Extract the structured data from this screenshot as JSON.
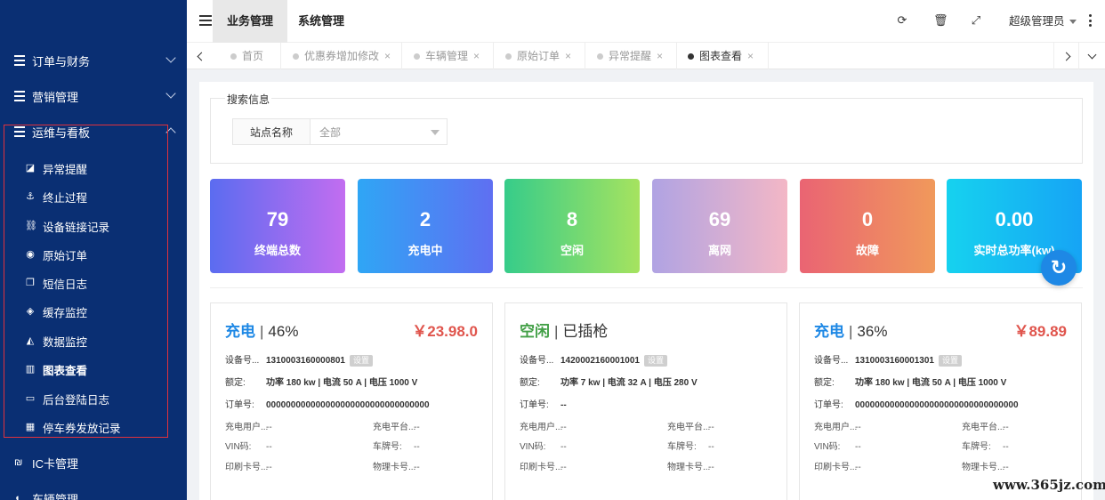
{
  "sidebar": {
    "groups": [
      {
        "label": "订单与财务"
      },
      {
        "label": "营销管理"
      },
      {
        "label": "运维与看板"
      },
      {
        "label": "IC卡管理"
      },
      {
        "label": "车辆管理"
      }
    ],
    "items": [
      {
        "label": "异常提醒",
        "icon": "dashboard-icon"
      },
      {
        "label": "终止过程",
        "icon": "anchor-icon"
      },
      {
        "label": "设备链接记录",
        "icon": "link-icon"
      },
      {
        "label": "原始订单",
        "icon": "compass-icon"
      },
      {
        "label": "短信日志",
        "icon": "copy-icon"
      },
      {
        "label": "缓存监控",
        "icon": "cache-icon"
      },
      {
        "label": "数据监控",
        "icon": "area-chart-icon"
      },
      {
        "label": "图表查看",
        "icon": "bar-chart-icon"
      },
      {
        "label": "后台登陆日志",
        "icon": "monitor-icon"
      },
      {
        "label": "停车券发放记录",
        "icon": "grid-icon"
      }
    ]
  },
  "header": {
    "tabs": [
      "业务管理",
      "系统管理"
    ],
    "user": "超级管理员"
  },
  "page_tabs": [
    {
      "label": "首页",
      "closable": false
    },
    {
      "label": "优惠券增加修改",
      "closable": true
    },
    {
      "label": "车辆管理",
      "closable": true
    },
    {
      "label": "原始订单",
      "closable": true
    },
    {
      "label": "异常提醒",
      "closable": true
    },
    {
      "label": "图表查看",
      "closable": true
    }
  ],
  "search": {
    "legend": "搜索信息",
    "station_label": "站点名称",
    "station_value": "全部"
  },
  "stats": [
    {
      "value": "79",
      "label": "终端总数"
    },
    {
      "value": "2",
      "label": "充电中"
    },
    {
      "value": "8",
      "label": "空闲"
    },
    {
      "value": "69",
      "label": "离网"
    },
    {
      "value": "0",
      "label": "故障"
    },
    {
      "value": "0.00",
      "label": "实时总功率(kw)"
    }
  ],
  "cards": [
    {
      "status": "充电",
      "status_color": "#1e88e5",
      "detail": "46%",
      "price": "￥23.98.0",
      "device_key": "设备号...",
      "device_no": "1310003160000801",
      "badge": "设置",
      "rated_key": "额定:",
      "rated": "功率 180 kw | 电流 50 A | 电压 1000 V",
      "order_key": "订单号:",
      "order": "000000000000000000000000000000000",
      "left_keys": [
        "充电用户...",
        "VIN码:",
        "印刷卡号..."
      ],
      "right_keys": [
        "充电平台...",
        "车牌号:",
        "物理卡号..."
      ],
      "dash": "--"
    },
    {
      "status": "空闲",
      "status_color": "#43a047",
      "detail": "已插枪",
      "price": "",
      "device_key": "设备号...",
      "device_no": "1420002160001001",
      "badge": "设置",
      "rated_key": "额定:",
      "rated": "功率 7 kw | 电流 32 A | 电压 280 V",
      "order_key": "订单号:",
      "order": "--",
      "left_keys": [
        "充电用户...",
        "VIN码:",
        "印刷卡号..."
      ],
      "right_keys": [
        "充电平台...",
        "车牌号:",
        "物理卡号..."
      ],
      "dash": "--"
    },
    {
      "status": "充电",
      "status_color": "#1e88e5",
      "detail": "36%",
      "price": "￥89.89",
      "device_key": "设备号...",
      "device_no": "1310003160001301",
      "badge": "设置",
      "rated_key": "额定:",
      "rated": "功率 180 kw | 电流 50 A | 电压 1000 V",
      "order_key": "订单号:",
      "order": "000000000000000000000000000000000",
      "left_keys": [
        "充电用户...",
        "VIN码:",
        "印刷卡号..."
      ],
      "right_keys": [
        "充电平台...",
        "车牌号:",
        "物理卡号..."
      ],
      "dash": "--"
    }
  ],
  "watermark": "www.365jz.com"
}
